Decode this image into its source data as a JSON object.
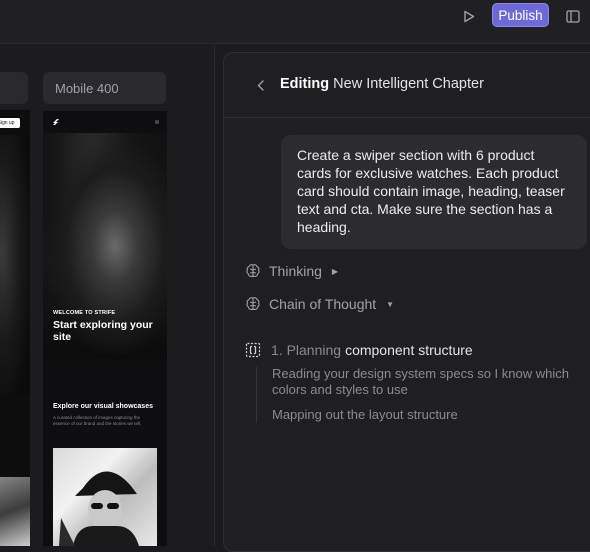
{
  "toolbar": {
    "publish_label": "Publish",
    "play_icon": "play-icon",
    "sidebar_icon": "sidebar-toggle-icon",
    "accent_color": "#6d6ad8"
  },
  "canvas": {
    "left_frame": {
      "signup_label": "Sign up"
    },
    "mobile_frame": {
      "label": "Mobile 400",
      "hero_eyebrow": "WELCOME TO STRIFE",
      "hero_title": "Start exploring your site",
      "section_title": "Explore our visual showcases",
      "section_description": "A curated collection of images capturing the essence of our brand and the stories we tell."
    }
  },
  "panel": {
    "header": {
      "prefix": "Editing",
      "title": "New Intelligent Chapter"
    },
    "prompt": "Create a swiper section with 6 product cards for exclusive watches. Each product card should contain image, heading, teaser text and cta. Make sure the section has a heading.",
    "thinking": {
      "label": "Thinking"
    },
    "chain": {
      "label": "Chain of Thought"
    },
    "step": {
      "number": "1. Planning",
      "title": "component structure",
      "substeps": [
        "Reading your design system specs so I know which colors and styles to use",
        "Mapping out the layout structure"
      ]
    }
  }
}
